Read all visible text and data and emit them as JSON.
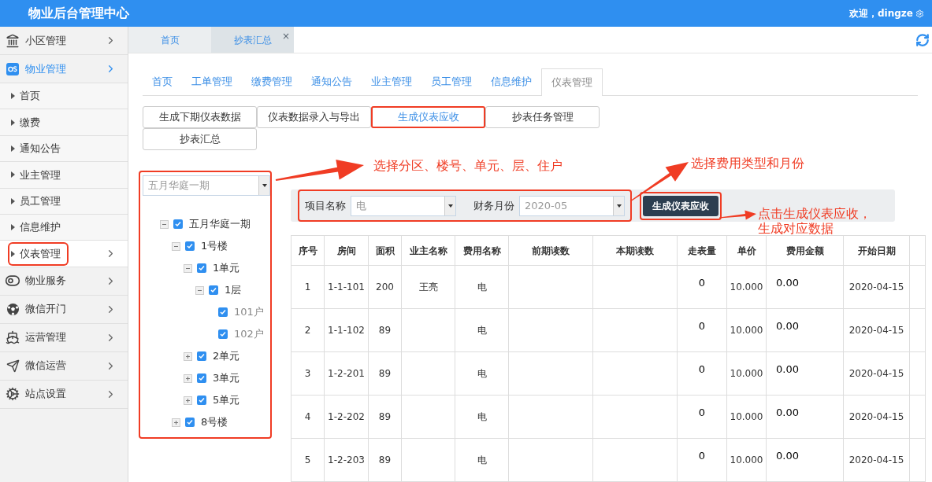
{
  "header": {
    "title": "物业后台管理中心",
    "welcome": "欢迎，dingze"
  },
  "sidebar": {
    "items": [
      {
        "label": "小区管理",
        "expanded": false
      },
      {
        "label": "物业管理",
        "expanded": true,
        "children": [
          {
            "label": "首页",
            "selected": false,
            "highlighted": false
          },
          {
            "label": "缴费",
            "selected": false,
            "highlighted": false
          },
          {
            "label": "通知公告",
            "selected": false,
            "highlighted": false
          },
          {
            "label": "业主管理",
            "selected": false,
            "highlighted": false
          },
          {
            "label": "员工管理",
            "selected": false,
            "highlighted": false
          },
          {
            "label": "信息维护",
            "selected": false,
            "highlighted": false
          },
          {
            "label": "仪表管理",
            "selected": true,
            "highlighted": true
          }
        ]
      },
      {
        "label": "物业服务",
        "expanded": false
      },
      {
        "label": "微信开门",
        "expanded": false
      },
      {
        "label": "运营管理",
        "expanded": false
      },
      {
        "label": "微信运营",
        "expanded": false
      },
      {
        "label": "站点设置",
        "expanded": false
      }
    ]
  },
  "page_tabs": [
    {
      "label": "首页",
      "selected": false
    },
    {
      "label": "抄表汇总",
      "selected": true,
      "close": "×"
    }
  ],
  "nav_tabs": [
    {
      "label": "首页",
      "selected": false
    },
    {
      "label": "工单管理",
      "selected": false
    },
    {
      "label": "缴费管理",
      "selected": false
    },
    {
      "label": "通知公告",
      "selected": false
    },
    {
      "label": "业主管理",
      "selected": false
    },
    {
      "label": "员工管理",
      "selected": false
    },
    {
      "label": "信息维护",
      "selected": false
    },
    {
      "label": "仪表管理",
      "selected": true
    }
  ],
  "sub_buttons": [
    {
      "label": "生成下期仪表数据",
      "selected": false,
      "highlighted": false
    },
    {
      "label": "仪表数据录入与导出",
      "selected": false,
      "highlighted": false
    },
    {
      "label": "生成仪表应收",
      "selected": true,
      "highlighted": true
    },
    {
      "label": "抄表任务管理",
      "selected": false,
      "highlighted": false
    },
    {
      "label": "抄表汇总",
      "selected": false,
      "highlighted": false
    }
  ],
  "tree": {
    "highlighted": true,
    "select": {
      "value": "五月华庭一期"
    },
    "nodes": [
      {
        "label": "五月华庭一期",
        "checked": true,
        "expanded": true,
        "children": [
          {
            "label": "1号楼",
            "checked": true,
            "expanded": true,
            "children": [
              {
                "label": "1单元",
                "checked": true,
                "expanded": true,
                "children": [
                  {
                    "label": "1层",
                    "checked": true,
                    "expanded": true,
                    "children": [
                      {
                        "label": "101户",
                        "checked": true
                      },
                      {
                        "label": "102户",
                        "checked": true
                      }
                    ]
                  }
                ]
              },
              {
                "label": "2单元",
                "checked": true,
                "expanded": false
              },
              {
                "label": "3单元",
                "checked": true,
                "expanded": false
              },
              {
                "label": "5单元",
                "checked": true,
                "expanded": false
              }
            ]
          },
          {
            "label": "8号楼",
            "checked": true,
            "expanded": false
          }
        ]
      }
    ]
  },
  "filter": {
    "highlighted": true,
    "fields": [
      {
        "label": "项目名称",
        "value": "电"
      },
      {
        "label": "财务月份",
        "value": "2020-05"
      }
    ],
    "button": {
      "label": "生成仪表应收",
      "highlighted": true
    }
  },
  "table": {
    "columns": [
      "序号",
      "房间",
      "面积",
      "业主名称",
      "费用名称",
      "前期读数",
      "本期读数",
      "走表量",
      "单价",
      "费用金额",
      "开始日期"
    ],
    "rows": [
      [
        "1",
        "1-1-101",
        "200",
        "王亮",
        "电",
        "",
        "",
        "0",
        "10.000",
        "0.00",
        "2020-04-15"
      ],
      [
        "2",
        "1-1-102",
        "89",
        "",
        "电",
        "",
        "",
        "0",
        "10.000",
        "0.00",
        "2020-04-15"
      ],
      [
        "3",
        "1-2-201",
        "89",
        "",
        "电",
        "",
        "",
        "0",
        "10.000",
        "0.00",
        "2020-04-15"
      ],
      [
        "4",
        "1-2-202",
        "89",
        "",
        "电",
        "",
        "",
        "0",
        "10.000",
        "0.00",
        "2020-04-15"
      ],
      [
        "5",
        "1-2-203",
        "89",
        "",
        "电",
        "",
        "",
        "0",
        "10.000",
        "0.00",
        "2020-04-15"
      ]
    ]
  },
  "annotations": [
    {
      "lines": [
        "选择分区、楼号、单元、层、住户"
      ]
    },
    {
      "lines": [
        "选择费用类型和月份"
      ]
    },
    {
      "lines": [
        "点击生成仪表应收，",
        "生成对应数据"
      ]
    }
  ]
}
